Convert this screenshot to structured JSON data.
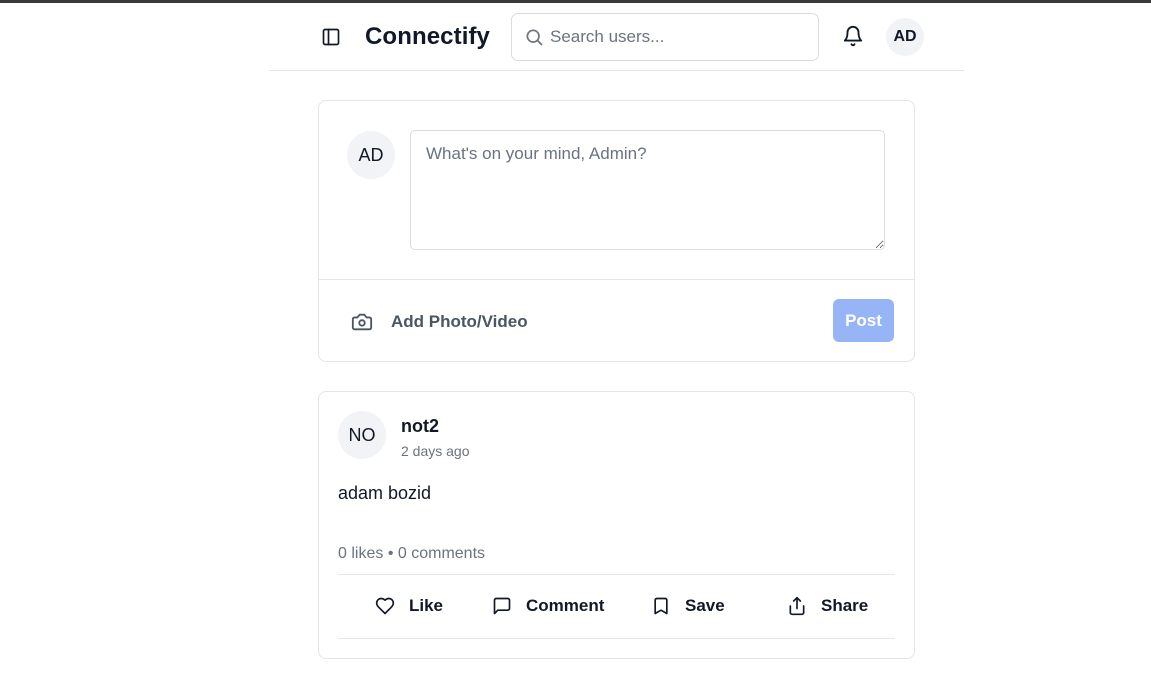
{
  "header": {
    "brand": "Connectify",
    "search_placeholder": "Search users...",
    "user_initials": "AD"
  },
  "composer": {
    "avatar_initials": "AD",
    "placeholder": "What's on your mind, Admin?",
    "add_media_label": "Add Photo/Video",
    "post_label": "Post",
    "post_button_color": "#97b4f6"
  },
  "post": {
    "avatar_initials": "NO",
    "author": "not2",
    "time": "2 days ago",
    "content": "adam bozid",
    "likes": "0 likes",
    "separator": "•",
    "comments": "0 comments",
    "actions": {
      "like": "Like",
      "comment": "Comment",
      "save": "Save",
      "share": "Share"
    }
  },
  "icons": {
    "sidebar_toggle": "panel-left-icon",
    "search": "search-icon",
    "notifications": "bell-icon",
    "media": "camera-icon",
    "like": "heart-icon",
    "comment": "message-square-icon",
    "save": "bookmark-icon",
    "share": "share-icon"
  }
}
